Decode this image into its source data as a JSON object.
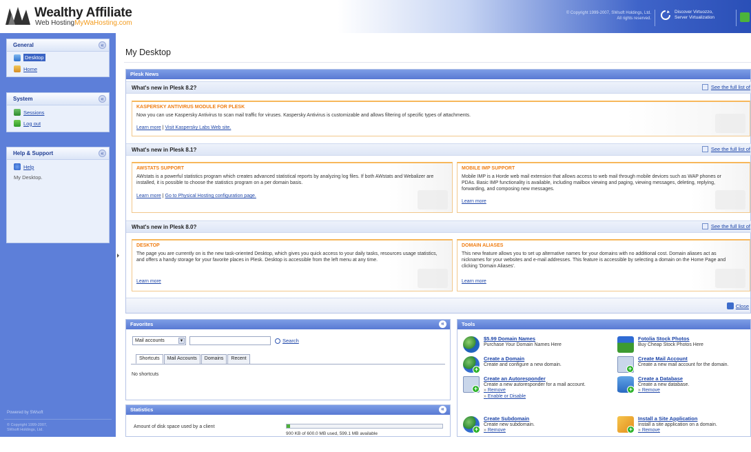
{
  "header": {
    "logo_title": "Wealthy Affiliate",
    "logo_sub_a": "Web Hosting",
    "logo_sub_b": "MyWaHosting.com",
    "copyright_1": "© Copyright 1999-2007, SWsoft Holdings, Ltd.",
    "copyright_2": "All rights reserved.",
    "discover_1": "Discover Virtuozzo,",
    "discover_2": "Server Virtualization"
  },
  "sidebar": {
    "general": {
      "title": "General",
      "collapse": "«",
      "items": [
        {
          "label": "Desktop"
        },
        {
          "label": "Home"
        }
      ]
    },
    "system": {
      "title": "System",
      "collapse": "«",
      "items": [
        {
          "label": "Sessions"
        },
        {
          "label": "Log out"
        }
      ]
    },
    "help": {
      "title": "Help & Support",
      "collapse": "«",
      "items": [
        {
          "label": "Help"
        }
      ],
      "context": "My Desktop."
    },
    "powered": "Powered by SWsoft",
    "footer_1": "© Copyright 1999-2007,",
    "footer_2": "SWsoft Holdings, Ltd."
  },
  "main": {
    "title": "My Desktop",
    "news": {
      "header": "Plesk News",
      "full_list": "See the full list of",
      "close": "Close",
      "sections": [
        {
          "title": "What's new in Plesk 8.2?",
          "cards": [
            {
              "title": "KASPERSKY ANTIVIRUS MODULE FOR PLESK",
              "body": "Now you can use Kaspersky Antivirus to scan mail traffic for viruses. Kaspersky Antivirus is customizable and allows filtering of specific types of attachments.",
              "link1": "Learn more",
              "link2": "Visit Kaspersky Labs Web site."
            }
          ]
        },
        {
          "title": "What's new in Plesk 8.1?",
          "cards": [
            {
              "title": "AWSTATS SUPPORT",
              "body": "AWstats is a powerful statistics program which creates advanced statistical reports by analyzing log files. If both AWstats and Webalizer are installed, it is possible to choose the statistics program on a per domain basis.",
              "link1": "Learn more",
              "link2": "Go to Physical Hosting configuration page."
            },
            {
              "title": "MOBILE IMP SUPPORT",
              "body": "Mobile IMP is a Horde web mail extension that allows access to web mail through mobile devices such as WAP phones or PDAs. Basic IMP functionality is available, including mailbox viewing and paging, viewing messages, deleting, replying, forwarding, and composing new messages.",
              "link1": "Learn more"
            }
          ]
        },
        {
          "title": "What's new in Plesk 8.0?",
          "cards": [
            {
              "title": "DESKTOP",
              "body": "The page you are currently on is the new task-oriented Desktop, which gives you quick access to your daily tasks, resources usage statistics, and offers a handy storage for your favorite places in Plesk. Desktop is accessible from the left menu at any time.",
              "link1": "Learn more"
            },
            {
              "title": "DOMAIN ALIASES",
              "body": "This new feature allows you to set up alternative names for your domains with no additional cost. Domain aliases act as nicknames for your websites and e-mail addresses. This feature is accessible by selecting a domain on the Home Page and clicking 'Domain Aliases'.",
              "link1": "Learn more"
            }
          ]
        }
      ]
    },
    "favorites": {
      "header": "Favorites",
      "select_value": "Mail accounts",
      "search_label": "Search",
      "tabs": [
        "Shortcuts",
        "Mail Accounts",
        "Domains",
        "Recent"
      ],
      "empty": "No shortcuts"
    },
    "statistics": {
      "header": "Statistics",
      "row_label": "Amount of disk space used by a client",
      "row_value": "900 KB of 600.0 MB used, 599.1 MB available",
      "used_fraction": 0.0015
    },
    "tools": {
      "header": "Tools",
      "items": [
        {
          "name": "$5.99 Domain Names",
          "desc": "Purchase Your Domain Names Here",
          "icon": "globe-icon"
        },
        {
          "name": "Fotolia Stock Photos",
          "desc": "Buy Cheap Stock Photos Here",
          "icon": "photos-icon"
        },
        {
          "name": "Create a Domain",
          "desc": "Create and configure a new domain.",
          "icon": "globe-plus-icon"
        },
        {
          "name": "Create Mail Account",
          "desc": "Create a new mail account for the domain.",
          "icon": "mail-plus-icon"
        },
        {
          "name": "Create an Autoresponder",
          "desc": "Create a new autoresponder for a mail account.",
          "icon": "autoresponder-plus-icon",
          "links": [
            "Remove",
            "Enable or Disable"
          ]
        },
        {
          "name": "Create a Database",
          "desc": "Create a new database.",
          "icon": "database-plus-icon",
          "links": [
            "Remove"
          ]
        },
        {
          "name": "Create Subdomain",
          "desc": "Create new subdomain.",
          "icon": "subdomain-plus-icon",
          "links": [
            "Remove"
          ]
        },
        {
          "name": "Install a Site Application",
          "desc": "Install a site application on a domain.",
          "icon": "site-app-plus-icon",
          "links": [
            "Remove"
          ]
        }
      ]
    }
  },
  "colors": {
    "nav_bg": "#5d7fd9",
    "panel_head": "#5879d3",
    "card_title": "#ef7d12",
    "link": "#1d45a8"
  }
}
